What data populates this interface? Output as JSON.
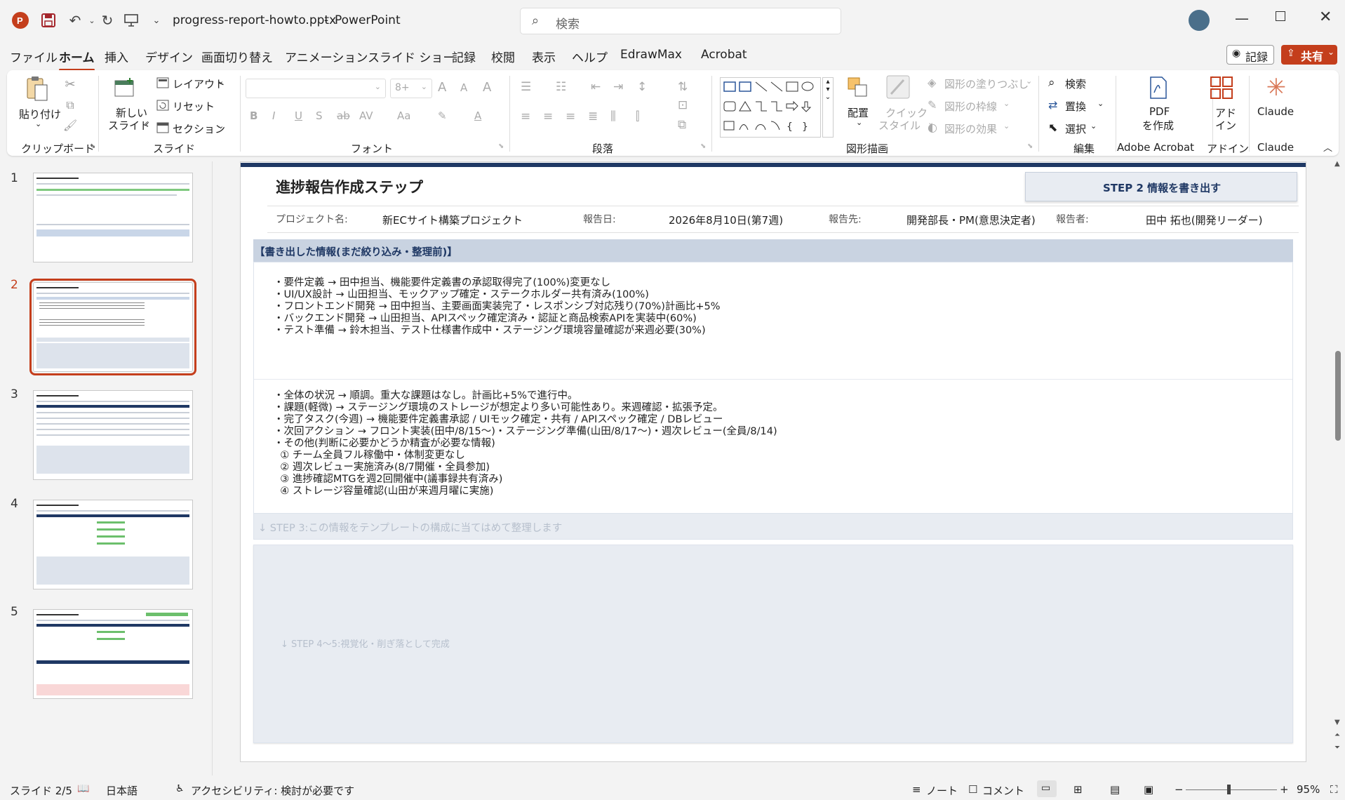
{
  "titlebar": {
    "filename": "progress-report-howto.pptx",
    "separator": "-",
    "app": "PowerPoint",
    "search_placeholder": "検索"
  },
  "menu": {
    "tabs": [
      "ファイル",
      "ホーム",
      "挿入",
      "デザイン",
      "画面切り替え",
      "アニメーション",
      "スライド ショー",
      "記録",
      "校閲",
      "表示",
      "ヘルプ",
      "EdrawMax",
      "Acrobat"
    ],
    "active": "ホーム",
    "record_label": "記録",
    "share_label": "共有"
  },
  "ribbon": {
    "clipboard": {
      "paste": "貼り付け",
      "group": "クリップボード"
    },
    "slides": {
      "new_slide_1": "新しい",
      "new_slide_2": "スライド",
      "layout": "レイアウト",
      "reset": "リセット",
      "section": "セクション",
      "group": "スライド"
    },
    "font": {
      "size": "8+",
      "group": "フォント"
    },
    "paragraph": {
      "group": "段落"
    },
    "drawing": {
      "arrange": "配置",
      "quick_style_1": "クイック",
      "quick_style_2": "スタイル",
      "fill": "図形の塗りつぶし",
      "outline": "図形の枠線",
      "effects": "図形の効果",
      "group": "図形描画"
    },
    "editing": {
      "find": "検索",
      "replace": "置換",
      "select": "選択",
      "group": "編集"
    },
    "acrobat": {
      "pdf_1": "PDF",
      "pdf_2": "を作成",
      "group": "Adobe Acrobat"
    },
    "addins": {
      "label_1": "アド",
      "label_2": "イン",
      "group": "アドイン"
    },
    "claude": {
      "label": "Claude",
      "group": "Claude"
    }
  },
  "thumbnails": {
    "numbers": [
      "1",
      "2",
      "3",
      "4",
      "5"
    ],
    "selected": "2"
  },
  "slide": {
    "title": "進捗報告作成ステップ",
    "step_badge": "STEP 2  情報を書き出す",
    "meta": [
      {
        "label": "プロジェクト名:",
        "value": "新ECサイト構築プロジェクト"
      },
      {
        "label": "報告日:",
        "value": "2026年8月10日(第7週)"
      },
      {
        "label": "報告先:",
        "value": "開発部長・PM(意思決定者)"
      },
      {
        "label": "報告者:",
        "value": "田中 拓也(開発リーダー)"
      }
    ],
    "section_header": "【書き出した情報(まだ絞り込み・整理前)】",
    "block1": [
      "・要件定義 → 田中担当、機能要件定義書の承認取得完了(100%)変更なし",
      "・UI/UX設計 → 山田担当、モックアップ確定・ステークホルダー共有済み(100%)",
      "・フロントエンド開発 → 田中担当、主要画面実装完了・レスポンシブ対応残り(70%)計画比+5%",
      "・バックエンド開発 → 山田担当、APIスペック確定済み・認証と商品検索APIを実装中(60%)",
      "・テスト準備 → 鈴木担当、テスト仕様書作成中・ステージング環境容量確認が来週必要(30%)"
    ],
    "block2": [
      "・全体の状況 → 順調。重大な課題はなし。計画比+5%で進行中。",
      "・課題(軽微) → ステージング環境のストレージが想定より多い可能性あり。来週確認・拡張予定。",
      "・完了タスク(今週) → 機能要件定義書承認 / UIモック確定・共有 / APIスペック確定 / DBレビュー",
      "・次回アクション → フロント実装(田中/8/15〜)・ステージング準備(山田/8/17〜)・週次レビュー(全員/8/14)",
      "・その他(判断に必要かどうか精査が必要な情報)",
      "  ① チーム全員フル稼働中・体制変更なし",
      "  ② 週次レビュー実施済み(8/7開催・全員参加)",
      "  ③ 進捗確認MTGを週2回開催中(議事録共有済み)",
      "  ④ ストレージ容量確認(山田が来週月曜に実施)"
    ],
    "step3": "↓ STEP 3:この情報をテンプレートの構成に当てはめて整理します",
    "step45": "↓ STEP 4〜5:視覚化・削ぎ落として完成"
  },
  "statusbar": {
    "slide_count": "スライド 2/5",
    "language": "日本語",
    "accessibility": "アクセシビリティ: 検討が必要です",
    "notes": "ノート",
    "comments": "コメント",
    "zoom": "95%",
    "zoom_level": 0.45
  },
  "colors": {
    "accent": "#c43e1c",
    "slide_navy": "#1f3864",
    "step_fill": "#dde3ec"
  }
}
